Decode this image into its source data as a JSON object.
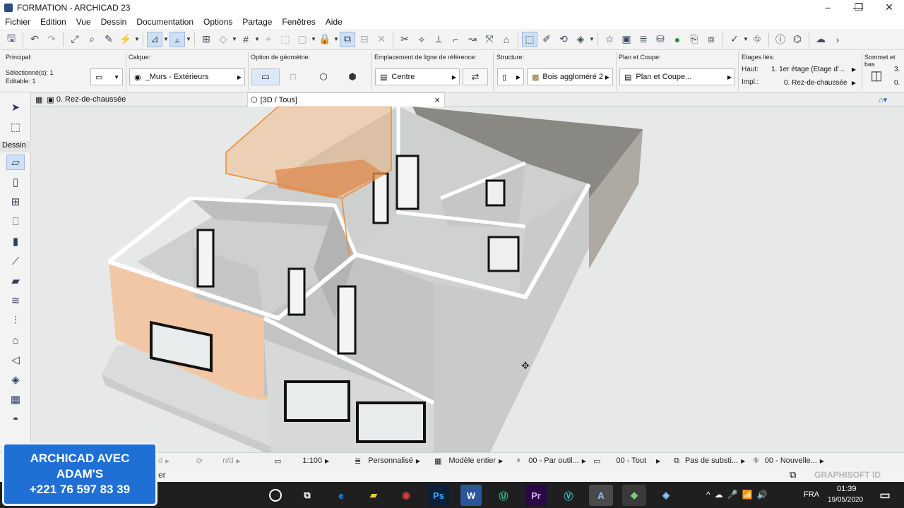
{
  "window": {
    "title": "FORMATION - ARCHICAD 23"
  },
  "menu": [
    "Fichier",
    "Edition",
    "Vue",
    "Dessin",
    "Documentation",
    "Options",
    "Partage",
    "Fenêtres",
    "Aide"
  ],
  "infobox": {
    "principal_label": "Principal:",
    "selected": "Sélectionné(s): 1",
    "editable": "Editable: 1",
    "calque_label": "Calque:",
    "calque_value": "_Murs - Extérieurs",
    "geometrie_label": "Option de géométrie:",
    "ligne_ref_label": "Emplacement de ligne de référence:",
    "ligne_ref_value": "Centre",
    "structure_label": "Structure:",
    "structure_value": "Bois aggloméré 2",
    "plan_coupe_label": "Plan et Coupe:",
    "plan_coupe_value": "Plan et Coupe...",
    "etages_label": "Etages liés:",
    "haut_label": "Haut:",
    "haut_value": "1. 1er étage (Etage d'...",
    "impl_label": "Impl.:",
    "impl_value": "0. Rez-de-chaussée",
    "sommet_label": "Sommet et bas",
    "sommet_val1": "3.",
    "sommet_val2": "0."
  },
  "tabs": {
    "plan": "0. Rez-de-chaussée",
    "view3d": "[3D / Tous]",
    "close": "×"
  },
  "toolbox": {
    "section": "Dessin"
  },
  "statusbar": {
    "nd1": "d",
    "nd2": "n/d",
    "scale": "1:100",
    "custom": "Personnalisé",
    "model": "Modèle entier",
    "pen": "00 - Par outil...",
    "all": "00 - Tout",
    "subst": "Pas de substi...",
    "nouvelle": "00 - Nouvelle...",
    "brand": "GRAPHISOFT ID"
  },
  "bottombar": {
    "partial": "er"
  },
  "taskbar": {
    "lang": "FRA",
    "time": "01:39",
    "date": "19/05/2020"
  },
  "overlay": {
    "line1": "ARCHICAD AVEC",
    "line2": "ADAM'S",
    "line3": "+221 76 597 83 39"
  },
  "colors": {
    "selection": "#f5a35c",
    "accent": "#1f6fd4"
  }
}
